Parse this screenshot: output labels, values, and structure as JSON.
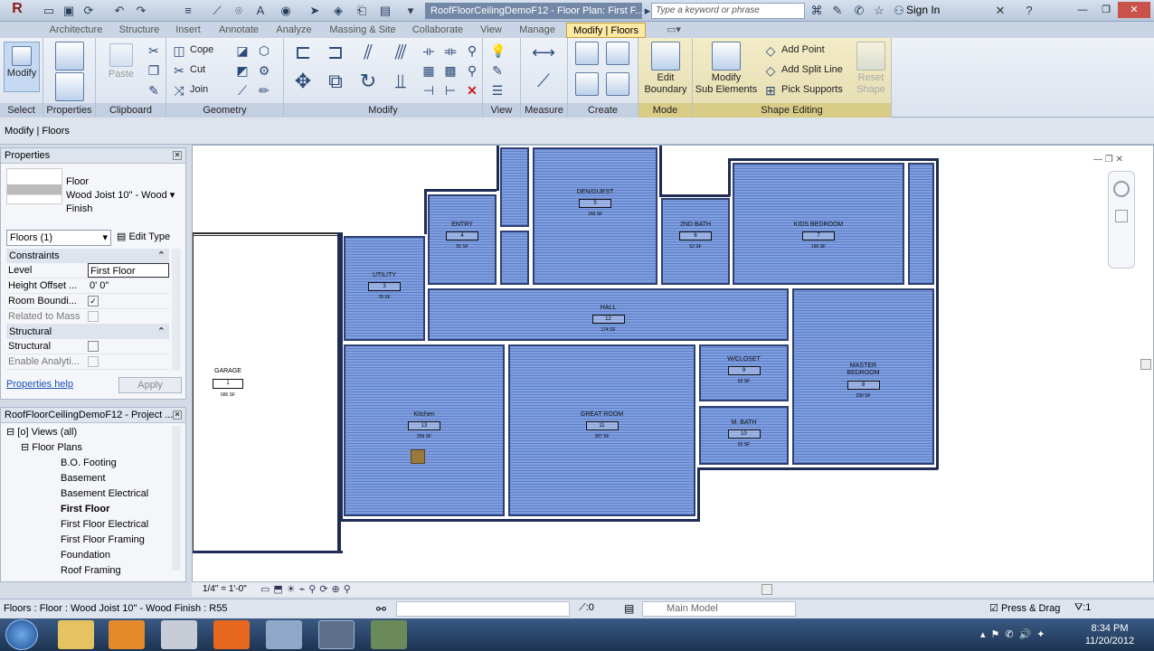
{
  "title_bar": {
    "document_title": "RoofFloorCeilingDemoF12 - Floor Plan: First F...",
    "search_placeholder": "Type a keyword or phrase",
    "sign_in": "Sign In"
  },
  "ribbon_tabs": [
    "Architecture",
    "Structure",
    "Insert",
    "Annotate",
    "Analyze",
    "Massing & Site",
    "Collaborate",
    "View",
    "Manage",
    "Modify | Floors"
  ],
  "active_tab": "Modify | Floors",
  "ribbon": {
    "select": {
      "modify": "Modify",
      "label": "Select"
    },
    "properties": {
      "label": "Properties"
    },
    "clipboard": {
      "paste": "Paste",
      "label": "Clipboard"
    },
    "geometry": {
      "cope": "Cope",
      "cut": "Cut",
      "join": "Join",
      "label": "Geometry"
    },
    "modify": {
      "label": "Modify"
    },
    "view": {
      "label": "View"
    },
    "measure": {
      "label": "Measure"
    },
    "create": {
      "label": "Create"
    },
    "mode": {
      "edit_boundary_1": "Edit",
      "edit_boundary_2": "Boundary",
      "label": "Mode"
    },
    "shape_editing": {
      "modify_sub_1": "Modify",
      "modify_sub_2": "Sub Elements",
      "add_point": "Add Point",
      "add_split_line": "Add Split Line",
      "pick_supports": "Pick Supports",
      "reset_1": "Reset",
      "reset_2": "Shape",
      "label": "Shape Editing"
    }
  },
  "options_bar": "Modify | Floors",
  "properties_palette": {
    "title": "Properties",
    "type_name_1": "Floor",
    "type_name_2": "Wood Joist 10\" - Wood",
    "type_name_3": "Finish",
    "selector": "Floors (1)",
    "edit_type": "Edit Type",
    "group_constraints": "Constraints",
    "rows": [
      {
        "k": "Level",
        "v": "First Floor"
      },
      {
        "k": "Height Offset ...",
        "v": "0'  0\""
      },
      {
        "k": "Room Boundi...",
        "v": "✓"
      },
      {
        "k": "Related to Mass",
        "v": ""
      }
    ],
    "group_structural": "Structural",
    "rows2": [
      {
        "k": "Structural",
        "v": ""
      },
      {
        "k": "Enable Analyti...",
        "v": ""
      }
    ],
    "help": "Properties help",
    "apply": "Apply"
  },
  "project_browser": {
    "title": "RoofFloorCeilingDemoF12 - Project ...",
    "views_all": "Views (all)",
    "floor_plans": "Floor Plans",
    "items": [
      "B.O. Footing",
      "Basement",
      "Basement Electrical",
      "First Floor",
      "First Floor Electrical",
      "First Floor Framing",
      "Foundation",
      "Roof Framing"
    ],
    "selected": "First Floor"
  },
  "rooms": [
    {
      "name": "GARAGE",
      "num": "1",
      "area": "686 SF"
    },
    {
      "name": "UTILITY",
      "num": "3",
      "area": "78 SF"
    },
    {
      "name": "ENTRY",
      "num": "4",
      "area": "55 SF"
    },
    {
      "name": "DEN/GUEST",
      "num": "5",
      "area": "166 SF"
    },
    {
      "name": "2ND BATH",
      "num": "6",
      "area": "52 SF"
    },
    {
      "name": "KIDS BEDROOM",
      "num": "7",
      "area": "190 SF"
    },
    {
      "name": "HALL",
      "num": "12",
      "area": "174 SF"
    },
    {
      "name": "Kitchen",
      "num": "13",
      "area": "256 SF"
    },
    {
      "name": "GREAT ROOM",
      "num": "11",
      "area": "287 SF"
    },
    {
      "name": "W/CLOSET",
      "num": "9",
      "area": "62 SF"
    },
    {
      "name": "M. BATH",
      "num": "10",
      "area": "62 SF"
    },
    {
      "name": "MASTER BEDROOM",
      "num": "8",
      "area": "230 SF"
    }
  ],
  "view_scale": "1/4\" = 1'-0\"",
  "status": {
    "text": "Floors : Floor : Wood Joist 10\" - Wood Finish : R55",
    "count": ":0",
    "model": "Main Model",
    "press_drag": "Press & Drag",
    "filter": ":1"
  },
  "clock": {
    "time": "8:34 PM",
    "date": "11/20/2012"
  }
}
